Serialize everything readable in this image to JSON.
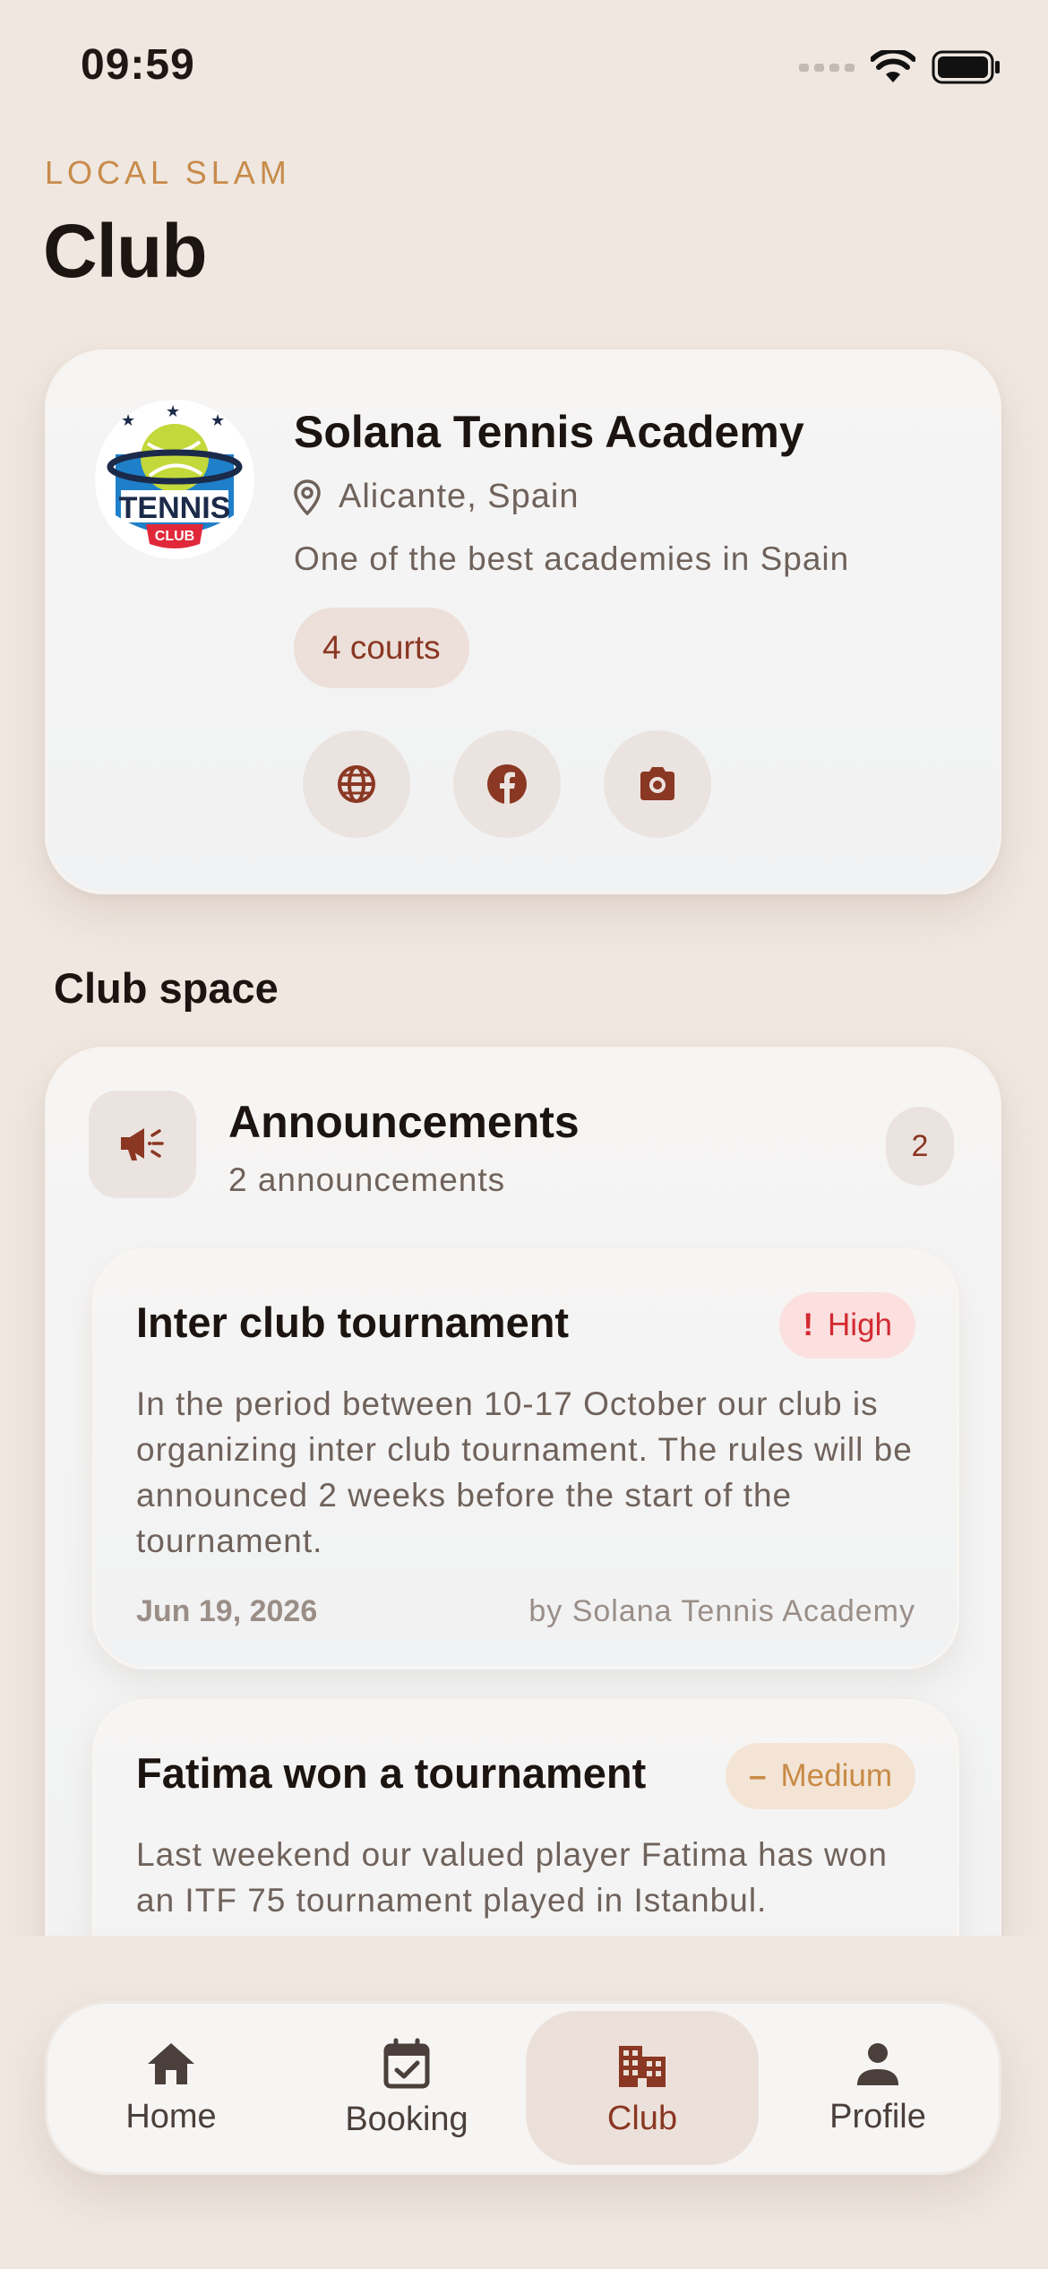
{
  "status_bar": {
    "time": "09:59"
  },
  "header": {
    "kicker": "LOCAL SLAM",
    "title": "Club"
  },
  "club": {
    "name": "Solana Tennis Academy",
    "location": "Alicante, Spain",
    "description": "One of the best academies in Spain",
    "courts_label": "4 courts",
    "logo": {
      "top_text": "TENNIS",
      "bottom_text": "CLUB"
    },
    "social": [
      {
        "icon": "globe-icon",
        "label": "website"
      },
      {
        "icon": "facebook-icon",
        "label": "facebook"
      },
      {
        "icon": "instagram-icon",
        "label": "instagram"
      }
    ]
  },
  "club_space": {
    "section_title": "Club space",
    "announcements": {
      "title": "Announcements",
      "subtitle": "2 announcements",
      "count": "2",
      "items": [
        {
          "title": "Inter club tournament",
          "priority": "High",
          "priority_symbol": "!",
          "body": "In the period between 10-17 October our club is organizing inter club tournament. The rules will be announced 2 weeks before the start of the tournament.",
          "date": "Jun 19, 2026",
          "author": "by Solana Tennis Academy"
        },
        {
          "title": "Fatima won a tournament",
          "priority": "Medium",
          "priority_symbol": "–",
          "body": "Last weekend our valued player Fatima has won an ITF 75 tournament played in Istanbul."
        }
      ]
    }
  },
  "nav": {
    "active": "Club",
    "items": [
      {
        "label": "Home",
        "icon": "home-icon"
      },
      {
        "label": "Booking",
        "icon": "calendar-icon"
      },
      {
        "label": "Club",
        "icon": "building-icon"
      },
      {
        "label": "Profile",
        "icon": "person-icon"
      }
    ]
  },
  "colors": {
    "background": "#efe7e0",
    "accent": "#8a3723",
    "kicker": "#c88b4a",
    "priority_high": "#d32a32",
    "priority_medium": "#c88a45"
  }
}
